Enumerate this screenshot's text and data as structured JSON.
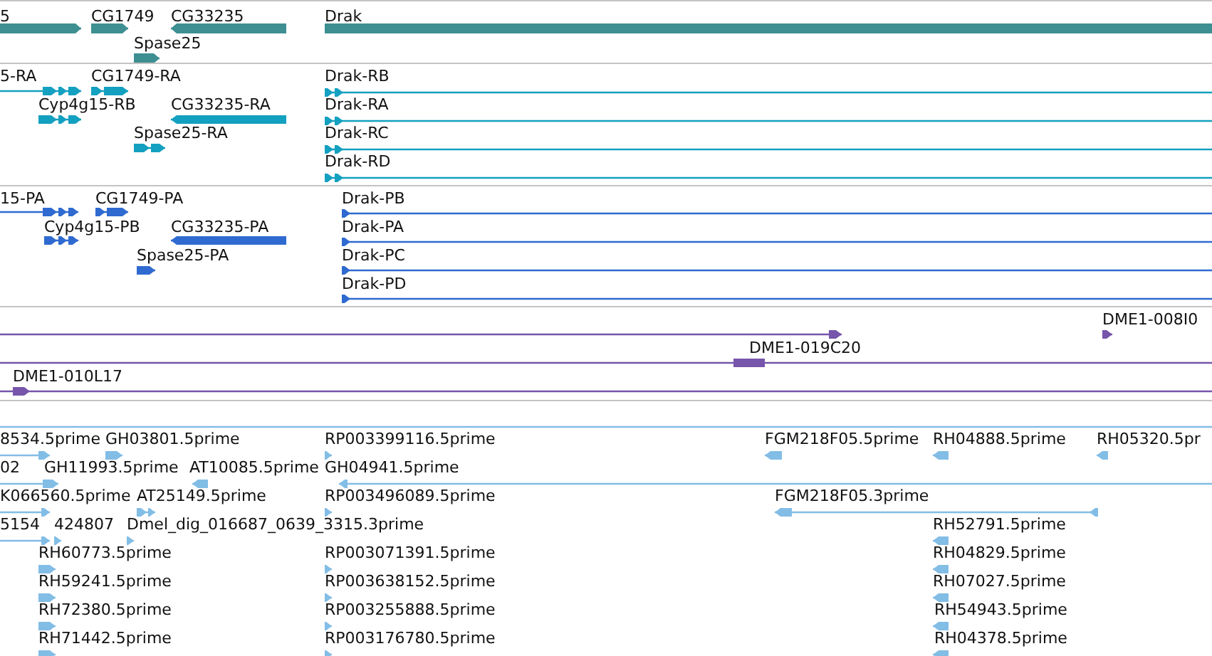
{
  "tracks": [
    {
      "kind": "gene",
      "features": [
        {
          "label": "5",
          "kind": "forward"
        },
        {
          "label": "CG1749",
          "kind": "forward"
        },
        {
          "label": "CG33235",
          "kind": "reverse"
        },
        {
          "label": "Drak",
          "kind": "plain"
        },
        {
          "label": "Spase25",
          "kind": "forward"
        }
      ]
    },
    {
      "kind": "transcript",
      "features": [
        {
          "label": "5-RA",
          "kind": "forward"
        },
        {
          "label": "CG1749-RA",
          "kind": "forward"
        },
        {
          "label": "Cyp4g15-RB",
          "kind": "forward"
        },
        {
          "label": "CG33235-RA",
          "kind": "reverse"
        },
        {
          "label": "Spase25-RA",
          "kind": "forward"
        },
        {
          "label": "Drak-RB",
          "kind": "forward"
        },
        {
          "label": "Drak-RA",
          "kind": "forward"
        },
        {
          "label": "Drak-RC",
          "kind": "forward"
        },
        {
          "label": "Drak-RD",
          "kind": "forward"
        }
      ]
    },
    {
      "kind": "protein",
      "features": [
        {
          "label": "15-PA",
          "kind": "forward"
        },
        {
          "label": "CG1749-PA",
          "kind": "forward"
        },
        {
          "label": "Cyp4g15-PB",
          "kind": "forward"
        },
        {
          "label": "CG33235-PA",
          "kind": "reverse"
        },
        {
          "label": "Spase25-PA",
          "kind": "forward"
        },
        {
          "label": "Drak-PB",
          "kind": "forward"
        },
        {
          "label": "Drak-PA",
          "kind": "forward"
        },
        {
          "label": "Drak-PC",
          "kind": "forward"
        },
        {
          "label": "Drak-PD",
          "kind": "forward"
        }
      ]
    },
    {
      "kind": "clone",
      "features": [
        {
          "kind": "forward"
        },
        {
          "label": "DME1-008I0",
          "kind": "forward"
        },
        {
          "label": "DME1-019C20",
          "kind": "plain"
        },
        {
          "label": "DME1-010L17",
          "kind": "forward"
        }
      ]
    },
    {
      "kind": "est",
      "features": [
        {
          "kind": "plain"
        },
        {
          "label": "8534.5prime",
          "kind": "forward"
        },
        {
          "label": "GH03801.5prime",
          "kind": "forward"
        },
        {
          "label": "RP003399116.5prime",
          "kind": "forward"
        },
        {
          "label": "FGM218F05.5prime",
          "kind": "reverse"
        },
        {
          "label": "RH04888.5prime",
          "kind": "reverse"
        },
        {
          "label": "RH05320.5pr",
          "kind": "reverse"
        },
        {
          "label": "02",
          "kind": "plain"
        },
        {
          "label": "GH11993.5prime",
          "kind": "forward"
        },
        {
          "label": "AT10085.5prime",
          "kind": "reverse"
        },
        {
          "label": "GH04941.5prime",
          "kind": "reverse"
        },
        {
          "label": "K066560.5prime",
          "kind": "forward"
        },
        {
          "label": "AT25149.5prime",
          "kind": "forward"
        },
        {
          "label": "RP003496089.5prime",
          "kind": "forward"
        },
        {
          "label": "FGM218F05.3prime",
          "kind": "reverse"
        },
        {
          "label": "5154",
          "kind": "forward"
        },
        {
          "label": "424807",
          "kind": "forward"
        },
        {
          "label": "Dmel_dig_016687_0639_3315.3prime",
          "kind": "forward"
        },
        {
          "label": "RH52791.5prime",
          "kind": "reverse"
        },
        {
          "label": "RH60773.5prime",
          "kind": "forward"
        },
        {
          "label": "RP003071391.5prime",
          "kind": "forward"
        },
        {
          "label": "RH04829.5prime",
          "kind": "reverse"
        },
        {
          "label": "RH59241.5prime",
          "kind": "forward"
        },
        {
          "label": "RP003638152.5prime",
          "kind": "forward"
        },
        {
          "label": "RH07027.5prime",
          "kind": "reverse"
        },
        {
          "label": "RH72380.5prime",
          "kind": "forward"
        },
        {
          "label": "RP003255888.5prime",
          "kind": "forward"
        },
        {
          "label": "RH54943.5prime",
          "kind": "reverse"
        },
        {
          "label": "RH71442.5prime",
          "kind": "forward"
        },
        {
          "label": "RP003176780.5prime",
          "kind": "forward"
        },
        {
          "label": "RH04378.5prime",
          "kind": "reverse"
        }
      ]
    }
  ]
}
